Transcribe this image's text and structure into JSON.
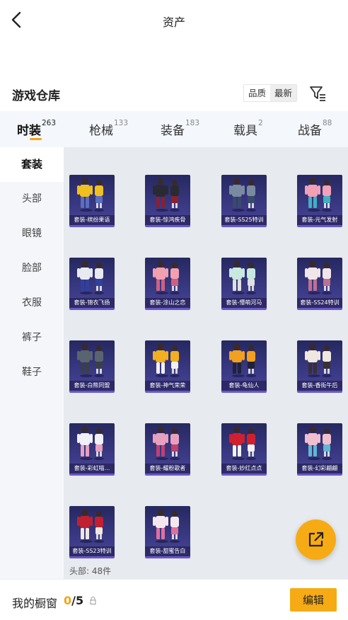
{
  "header": {
    "title": "资产"
  },
  "warehouse": {
    "title": "游戏仓库",
    "sort_options": [
      "品质",
      "最新"
    ],
    "sort_active": "最新"
  },
  "tabs": [
    {
      "label": "时装",
      "count": "263",
      "active": true
    },
    {
      "label": "枪械",
      "count": "133",
      "active": false
    },
    {
      "label": "装备",
      "count": "183",
      "active": false
    },
    {
      "label": "载具",
      "count": "2",
      "active": false
    },
    {
      "label": "战备",
      "count": "88",
      "active": false
    }
  ],
  "sidebar": [
    {
      "label": "套装",
      "active": true
    },
    {
      "label": "头部",
      "active": false
    },
    {
      "label": "眼镜",
      "active": false
    },
    {
      "label": "脸部",
      "active": false
    },
    {
      "label": "衣服",
      "active": false
    },
    {
      "label": "裤子",
      "active": false
    },
    {
      "label": "鞋子",
      "active": false
    }
  ],
  "items": [
    {
      "label": "套装-缤纷果语",
      "top": "#f0c020",
      "bottom": "#5a6fc0"
    },
    {
      "label": "套装-惊鸿疾骨",
      "top": "#2a2a34",
      "bottom": "#8a2030"
    },
    {
      "label": "套装-SS25特训",
      "top": "#7a8aa0",
      "bottom": "#3a4a6a"
    },
    {
      "label": "套装-元气发射",
      "top": "#f2a0b8",
      "bottom": "#40b0c0"
    },
    {
      "label": "套装-锦衣飞扬",
      "top": "#e8eaf0",
      "bottom": "#3040a0"
    },
    {
      "label": "套装-涂山之恋",
      "top": "#f0a0b0",
      "bottom": "#d06080"
    },
    {
      "label": "套装-懵萌河马",
      "top": "#c8e8e0",
      "bottom": "#e0e0e0"
    },
    {
      "label": "套装-SS24特训",
      "top": "#f0e6ea",
      "bottom": "#c07090"
    },
    {
      "label": "套装-白熊同盟",
      "top": "#5a6470",
      "bottom": "#3a3f4a"
    },
    {
      "label": "套装-神气荣荣",
      "top": "#f2b020",
      "bottom": "#f0f0f0"
    },
    {
      "label": "套装-龟仙人",
      "top": "#f2a020",
      "bottom": "#20223a"
    },
    {
      "label": "套装-香街午后",
      "top": "#efe8e0",
      "bottom": "#3a3030"
    },
    {
      "label": "套装-彩虹喵...",
      "top": "#f0f0f8",
      "bottom": "#e8a0c0"
    },
    {
      "label": "套装-耀粉歌者",
      "top": "#e8a0c0",
      "bottom": "#c04070"
    },
    {
      "label": "套装-妙红点点",
      "top": "#d02030",
      "bottom": "#f2f2f2"
    },
    {
      "label": "套装-幻彩翩翩",
      "top": "#f0c0d0",
      "bottom": "#60b8d0"
    },
    {
      "label": "套装-SS23特训",
      "top": "#c02030",
      "bottom": "#f0e8e0"
    },
    {
      "label": "套装-甜蜜告白",
      "top": "#f4e8ee",
      "bottom": "#e070a0"
    }
  ],
  "head_count": "头部: 48件",
  "bottom": {
    "window_label": "我的橱窗",
    "window_used": "0",
    "window_total": "/5",
    "edit_label": "编辑"
  },
  "colors": {
    "accent": "#f6ab14",
    "card_bg": "#2f2f70",
    "card_border": "#6a57c9"
  },
  "icons": {
    "back": "chevron-left-icon",
    "filter": "filter-icon",
    "share": "external-link-icon",
    "lock": "lock-icon"
  }
}
